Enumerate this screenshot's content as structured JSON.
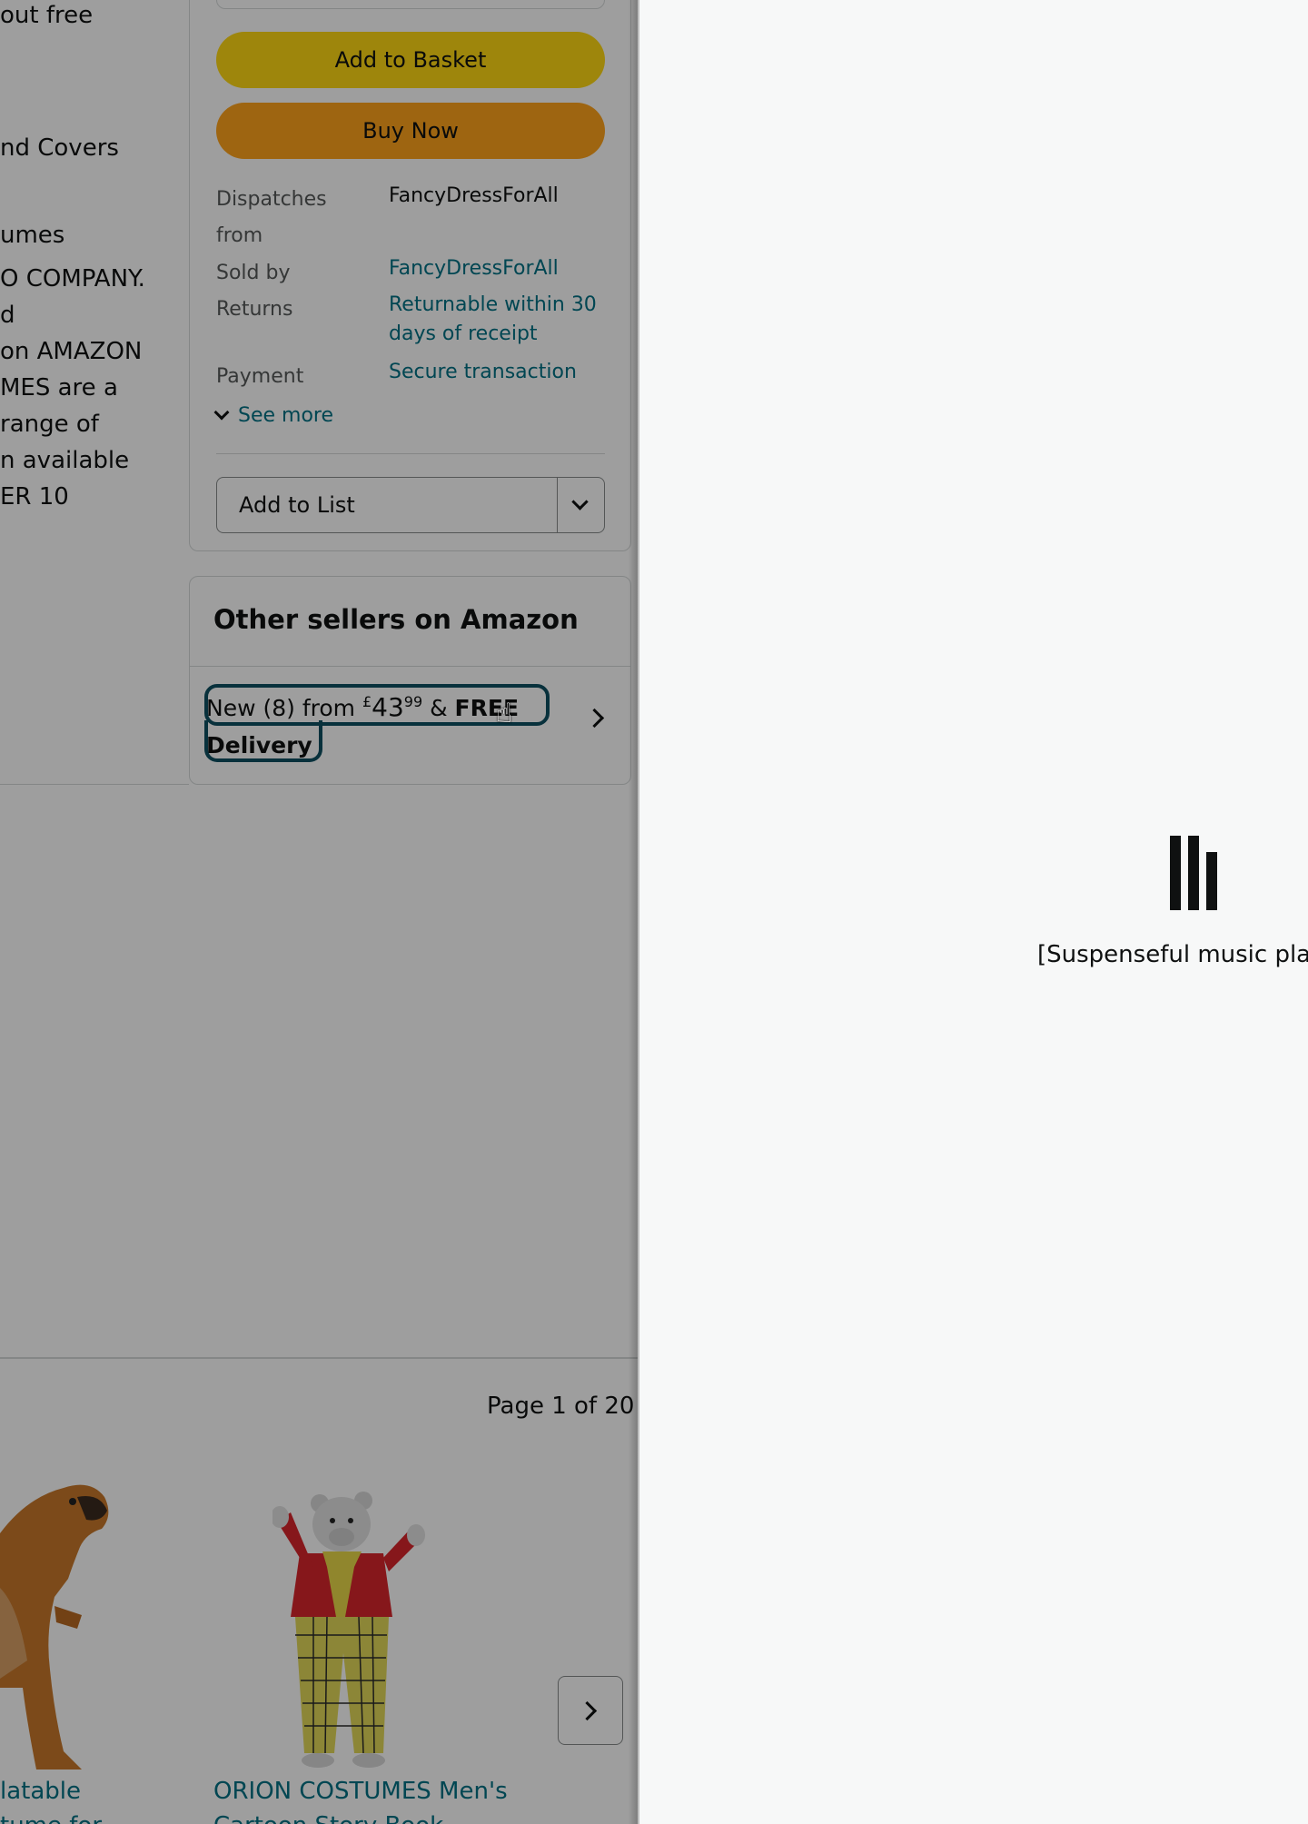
{
  "description_lines": [
    "out free",
    "nd Covers",
    "umes",
    "O COMPANY.",
    "d",
    "on AMAZON",
    "MES are a",
    "range of",
    "n available",
    "ER 10"
  ],
  "buy_box": {
    "add_to_basket": "Add to Basket",
    "buy_now": "Buy Now",
    "dispatches_label": "Dispatches from",
    "dispatches_value": "FancyDressForAll",
    "sold_by_label": "Sold by",
    "sold_by_value": "FancyDressForAll",
    "returns_label": "Returns",
    "returns_value": "Returnable within 30 days of receipt",
    "payment_label": "Payment",
    "payment_value": "Secure transaction",
    "see_more": "See more",
    "add_to_list": "Add to List"
  },
  "other_sellers": {
    "title": "Other sellers on Amazon",
    "offer_prefix": "New (8) from ",
    "currency": "£",
    "price_whole": "43",
    "price_fraction": "99",
    "offer_mid": " & ",
    "free_label": "FREE",
    "delivery_label": "Delivery"
  },
  "carousel": {
    "page_indicator": "Page 1 of 20",
    "products": [
      {
        "title_line1": "latable",
        "title_line2": "tume for"
      },
      {
        "title_line1": "ORION COSTUMES Men's",
        "title_line2": "Cartoon Story Book"
      }
    ]
  },
  "media_panel": {
    "caption": "[Suspenseful music play"
  }
}
